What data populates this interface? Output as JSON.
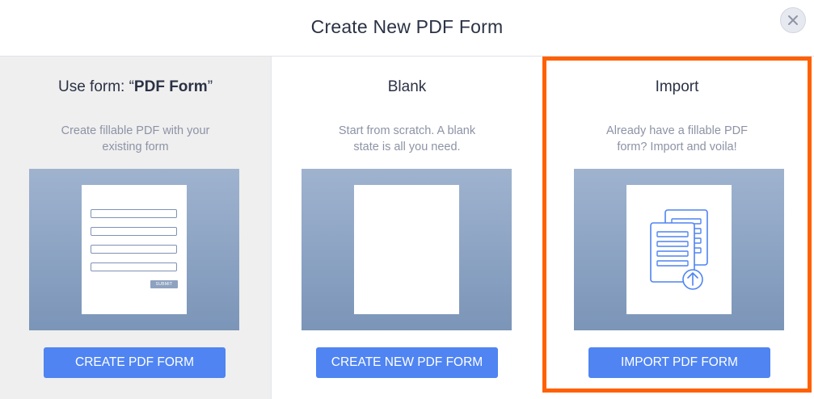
{
  "header": {
    "title": "Create New PDF Form"
  },
  "options": [
    {
      "title_prefix": "Use form: “",
      "title_bold": "PDF Form",
      "title_suffix": "”",
      "description_line1": "Create fillable PDF with your",
      "description_line2": "existing form",
      "preview_submit_label": "SUBMIT",
      "button_label": "CREATE PDF FORM"
    },
    {
      "title": "Blank",
      "description_line1": "Start from scratch. A blank",
      "description_line2": "state is all you need.",
      "button_label": "CREATE NEW PDF FORM"
    },
    {
      "title": "Import",
      "description_line1": "Already have a fillable PDF",
      "description_line2": "form? Import and voila!",
      "button_label": "IMPORT PDF FORM",
      "highlighted": true,
      "preview_icon": "document-upload-icon"
    }
  ],
  "colors": {
    "accent_button": "#4f84f2",
    "highlight_border": "#ff6100",
    "preview_gradient_top": "#9fb3cf",
    "preview_gradient_bottom": "#7b95b8",
    "icon_stroke": "#4f84f2"
  }
}
